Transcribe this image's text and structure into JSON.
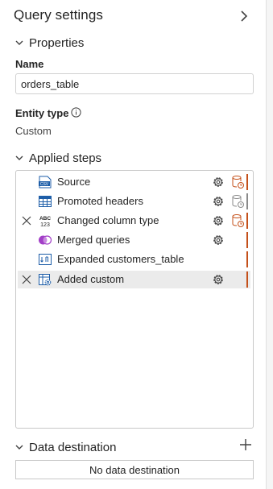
{
  "panel": {
    "title": "Query settings"
  },
  "properties": {
    "section_label": "Properties",
    "name_label": "Name",
    "name_value": "orders_table",
    "entity_type_label": "Entity type",
    "entity_type_value": "Custom"
  },
  "applied_steps": {
    "section_label": "Applied steps",
    "items": [
      {
        "label": "Source",
        "icon": "csv-icon",
        "deletable": false,
        "selected": false,
        "has_gear": true,
        "db_status": "warning",
        "bar_color": "#c4501a"
      },
      {
        "label": "Promoted headers",
        "icon": "table-icon",
        "deletable": false,
        "selected": false,
        "has_gear": true,
        "db_status": "neutral",
        "bar_color": "#8a8a8a"
      },
      {
        "label": "Changed column type",
        "icon": "abc-123-icon",
        "deletable": true,
        "selected": false,
        "has_gear": true,
        "db_status": "warning",
        "bar_color": "#c4501a"
      },
      {
        "label": "Merged queries",
        "icon": "merge-icon",
        "deletable": false,
        "selected": false,
        "has_gear": true,
        "db_status": "none",
        "bar_color": "#c4501a"
      },
      {
        "label": "Expanded customers_table",
        "icon": "expand-column-icon",
        "deletable": false,
        "selected": false,
        "has_gear": false,
        "db_status": "none",
        "bar_color": "#c4501a"
      },
      {
        "label": "Added custom",
        "icon": "custom-column-icon",
        "deletable": true,
        "selected": true,
        "has_gear": true,
        "db_status": "none",
        "bar_color": "#c4501a"
      }
    ]
  },
  "data_destination": {
    "section_label": "Data destination",
    "value": "No data destination"
  },
  "colors": {
    "warning": "#c4501a",
    "neutral": "#8a8a8a",
    "merge_purple": "#a23fc7",
    "icon_blue": "#1e5ea8"
  }
}
